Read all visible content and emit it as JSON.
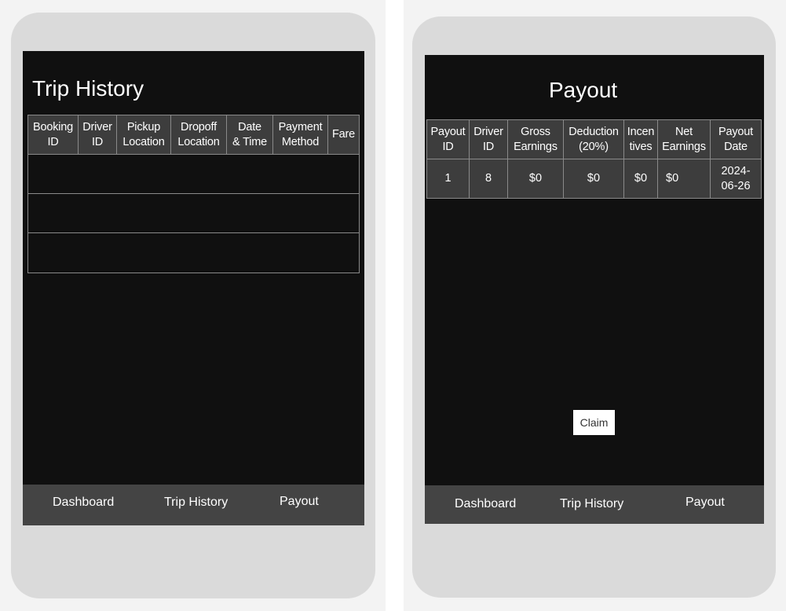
{
  "trip_history_screen": {
    "title": "Trip History",
    "table": {
      "headers": [
        [
          "Booking",
          "ID"
        ],
        [
          "Driver",
          "ID"
        ],
        [
          "Pickup",
          "Location"
        ],
        [
          "Dropoff",
          "Location"
        ],
        [
          "Date",
          "& Time"
        ],
        [
          "Payment",
          "Method"
        ],
        [
          "Fare"
        ]
      ],
      "rows": [
        [
          "",
          "",
          "",
          "",
          "",
          "",
          ""
        ],
        [
          "",
          "",
          "",
          "",
          "",
          "",
          ""
        ],
        [
          "",
          "",
          "",
          "",
          "",
          "",
          ""
        ]
      ]
    },
    "nav": [
      "Dashboard",
      "Trip History",
      "Payout"
    ]
  },
  "payout_screen": {
    "title": "Payout",
    "table": {
      "headers": [
        [
          "Payout",
          "ID"
        ],
        [
          "Driver",
          "ID"
        ],
        [
          "Gross",
          "Earnings"
        ],
        [
          "Deduction",
          "(20%)"
        ],
        [
          "Incen",
          "tives"
        ],
        [
          "Net",
          "Earnings"
        ],
        [
          "Payout",
          "Date"
        ]
      ],
      "rows": [
        [
          "1",
          "8",
          "$0",
          "$0",
          "$0",
          "$0",
          "2024-\n06-26"
        ]
      ]
    },
    "claim_label": "Claim",
    "nav": [
      "Dashboard",
      "Trip History",
      "Payout"
    ]
  },
  "colors": {
    "screen_bg": "#101010",
    "table_header_bg": "#3d3d3d",
    "navbar_bg": "#444444",
    "phone_frame": "#dadada"
  }
}
